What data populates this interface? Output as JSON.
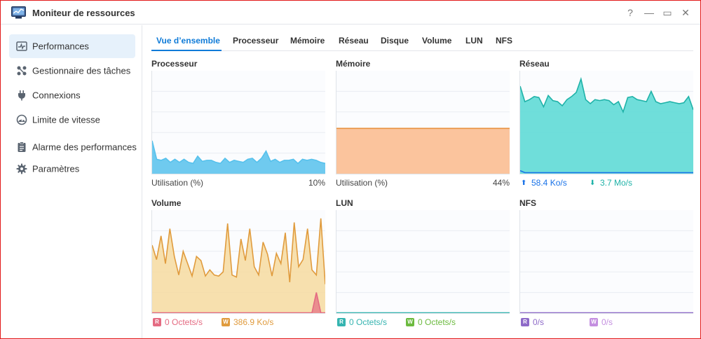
{
  "window": {
    "title": "Moniteur de ressources",
    "controls": {
      "help": "?",
      "minimize": "—",
      "maximize": "▭",
      "close": "✕"
    }
  },
  "sidebar": {
    "items": [
      {
        "label": "Performances",
        "icon": "performance-icon",
        "active": true
      },
      {
        "label": "Gestionnaire des tâches",
        "icon": "task-manager-icon",
        "active": false
      },
      {
        "label": "Connexions",
        "icon": "plug-icon",
        "active": false
      },
      {
        "label": "Limite de vitesse",
        "icon": "speed-gauge-icon",
        "active": false
      },
      {
        "label": "Alarme des performances",
        "icon": "clipboard-alarm-icon",
        "active": false
      },
      {
        "label": "Paramètres",
        "icon": "gear-icon",
        "active": false
      }
    ]
  },
  "tabs": [
    {
      "label": "Vue d’ensemble",
      "active": true
    },
    {
      "label": "Processeur",
      "active": false
    },
    {
      "label": "Mémoire",
      "active": false
    },
    {
      "label": "Réseau",
      "active": false
    },
    {
      "label": "Disque",
      "active": false
    },
    {
      "label": "Volume",
      "active": false
    },
    {
      "label": "LUN",
      "active": false
    },
    {
      "label": "NFS",
      "active": false
    }
  ],
  "panels": {
    "processor": {
      "title": "Processeur",
      "foot_label": "Utilisation  (%)",
      "foot_value": "10%"
    },
    "memory": {
      "title": "Mémoire",
      "foot_label": "Utilisation  (%)",
      "foot_value": "44%"
    },
    "network": {
      "title": "Réseau",
      "upload": "58.4 Ko/s",
      "download": "3.7 Mo/s"
    },
    "volume": {
      "title": "Volume",
      "read_badge": "R",
      "read": "0 Octets/s",
      "write_badge": "W",
      "write": "386.9 Ko/s"
    },
    "lun": {
      "title": "LUN",
      "read_badge": "R",
      "read": "0 Octets/s",
      "write_badge": "W",
      "write": "0 Octets/s"
    },
    "nfs": {
      "title": "NFS",
      "read_badge": "R",
      "read": "0/s",
      "write_badge": "W",
      "write": "0/s"
    }
  },
  "colors": {
    "accent": "#0f7bd8",
    "processor": "#56c1ec",
    "memory_fill": "#fbc49d",
    "memory_line": "#e8913f",
    "network_fill": "#5fdad6",
    "network_line": "#1fb2a8",
    "network_upload": "#1a73e8",
    "volume_fill": "#f6d89a",
    "volume_line": "#e09b3d",
    "volume_read": "#e46b82",
    "lun_read": "#35b4b0",
    "lun_write": "#6cba3f",
    "nfs_read": "#8e6ac8",
    "nfs_write": "#c48fe0"
  },
  "chart_data": [
    {
      "id": "processor",
      "type": "area",
      "ylim": [
        0,
        100
      ],
      "grid": true,
      "series": [
        {
          "values": [
            32,
            14,
            13,
            15,
            11,
            14,
            11,
            14,
            11,
            10,
            17,
            12,
            13,
            13,
            11,
            10,
            15,
            11,
            13,
            12,
            11,
            14,
            15,
            11,
            15,
            22,
            12,
            14,
            11,
            13,
            13,
            14,
            10,
            14,
            13,
            14,
            13,
            11,
            10
          ]
        }
      ]
    },
    {
      "id": "memory",
      "type": "area",
      "ylim": [
        0,
        100
      ],
      "grid": true,
      "series": [
        {
          "values": [
            44,
            44,
            44,
            44,
            44,
            44,
            44,
            44,
            44,
            44,
            44,
            44,
            44,
            44,
            44,
            44,
            44,
            44,
            44,
            44
          ]
        }
      ]
    },
    {
      "id": "network",
      "type": "area",
      "ylim": [
        0,
        100
      ],
      "grid": true,
      "series": [
        {
          "values": [
            85,
            70,
            72,
            75,
            74,
            65,
            76,
            71,
            70,
            66,
            72,
            75,
            79,
            92,
            72,
            68,
            72,
            71,
            72,
            71,
            67,
            70,
            60,
            74,
            75,
            72,
            71,
            70,
            80,
            70,
            68,
            69,
            70,
            69,
            68,
            69,
            75,
            62
          ]
        },
        {
          "values": [
            3,
            1,
            1,
            1,
            1,
            1,
            1,
            1,
            1,
            1,
            1,
            1,
            1,
            1,
            1,
            1,
            1,
            1,
            1,
            1,
            1,
            1,
            1,
            1,
            1,
            1,
            1,
            1,
            1,
            1,
            1,
            1,
            1,
            1,
            1,
            1,
            1,
            1
          ]
        }
      ]
    },
    {
      "id": "volume",
      "type": "area",
      "ylim": [
        0,
        100
      ],
      "grid": true,
      "series": [
        {
          "values": [
            66,
            52,
            75,
            48,
            82,
            55,
            37,
            60,
            48,
            36,
            55,
            51,
            36,
            42,
            37,
            36,
            40,
            87,
            37,
            35,
            72,
            51,
            82,
            45,
            37,
            69,
            57,
            36,
            58,
            48,
            78,
            30,
            88,
            45,
            52,
            82,
            42,
            37,
            92,
            28
          ]
        },
        {
          "values": [
            0,
            0,
            0,
            0,
            0,
            0,
            0,
            0,
            0,
            0,
            0,
            0,
            0,
            0,
            0,
            0,
            0,
            0,
            0,
            0,
            0,
            0,
            0,
            0,
            0,
            0,
            0,
            0,
            0,
            0,
            0,
            0,
            0,
            0,
            0,
            0,
            0,
            20,
            0,
            0
          ]
        }
      ]
    },
    {
      "id": "lun",
      "type": "area",
      "ylim": [
        0,
        100
      ],
      "grid": true,
      "series": [
        {
          "values": [
            0,
            0,
            0,
            0,
            0,
            0,
            0,
            0,
            0,
            0
          ]
        }
      ]
    },
    {
      "id": "nfs",
      "type": "area",
      "ylim": [
        0,
        100
      ],
      "grid": true,
      "series": [
        {
          "values": [
            0,
            0,
            0,
            0,
            0,
            0,
            0,
            0,
            0,
            0
          ]
        }
      ]
    }
  ]
}
